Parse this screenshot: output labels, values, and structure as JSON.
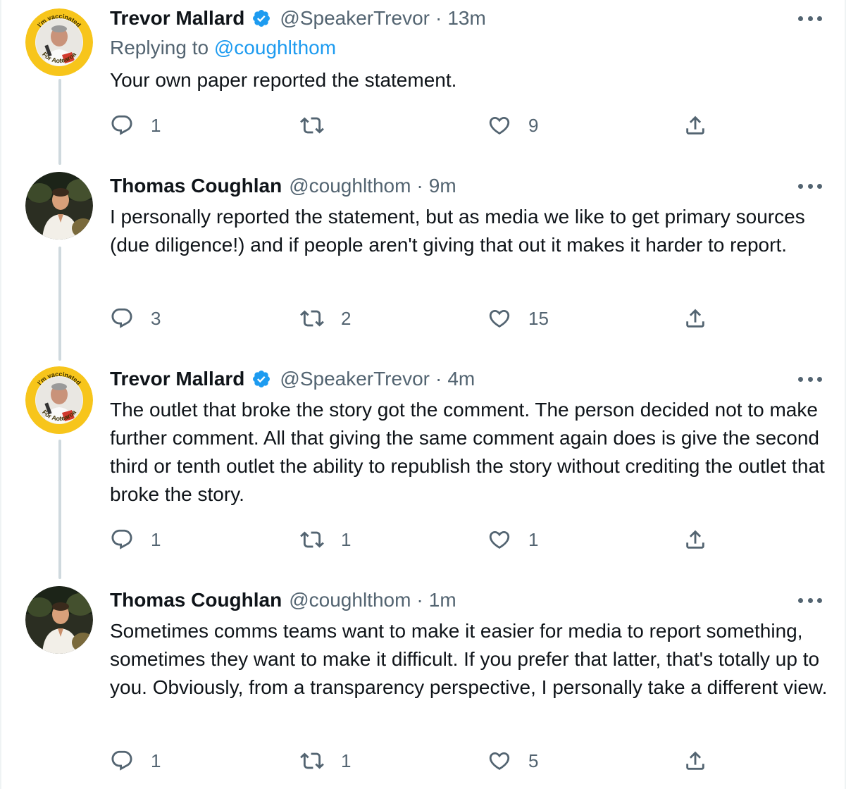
{
  "replying_label": "Replying to",
  "tweets": [
    {
      "name": "Trevor Mallard",
      "handle": "@SpeakerTrevor",
      "separator": "·",
      "time": "13m",
      "verified": true,
      "avatar_ring_text_top": "I'm vaccinated",
      "avatar_ring_text_bottom": "For Aotearoa",
      "replying_to": "@coughlthom",
      "text": "Your own paper reported the statement.",
      "replies": "1",
      "retweets": "",
      "likes": "9"
    },
    {
      "name": "Thomas Coughlan",
      "handle": "@coughlthom",
      "separator": "·",
      "time": "9m",
      "verified": false,
      "text": "I personally reported the statement, but as media we like to get primary sources (due diligence!) and if people aren't giving that out it makes it harder to report.",
      "replies": "3",
      "retweets": "2",
      "likes": "15"
    },
    {
      "name": "Trevor Mallard",
      "handle": "@SpeakerTrevor",
      "separator": "·",
      "time": "4m",
      "verified": true,
      "avatar_ring_text_top": "I'm vaccinated",
      "avatar_ring_text_bottom": "For Aotearoa",
      "text": "The outlet that broke the story got the comment. The person decided not to make further comment. All that giving the same comment again does is give the second third or tenth outlet the ability to republish the story without crediting the outlet that broke the story.",
      "replies": "1",
      "retweets": "1",
      "likes": "1"
    },
    {
      "name": "Thomas Coughlan",
      "handle": "@coughlthom",
      "separator": "·",
      "time": "1m",
      "verified": false,
      "text": "Sometimes comms teams want to make it easier for media to report something, sometimes they want to make it difficult. If you prefer that latter, that's totally up to you. Obviously, from a transparency perspective, I personally take a different view.",
      "replies": "1",
      "retweets": "1",
      "likes": "5"
    }
  ],
  "icons": {
    "reply": "reply-icon",
    "retweet": "retweet-icon",
    "like": "like-icon",
    "share": "share-icon",
    "more": "more-icon",
    "verified": "verified-badge-icon"
  },
  "colors": {
    "accent": "#1d9bf0",
    "secondary_text": "#536471",
    "primary_text": "#0f1419",
    "thread_line": "#cfd9de",
    "vaccine_ring": "#f7c51b"
  }
}
